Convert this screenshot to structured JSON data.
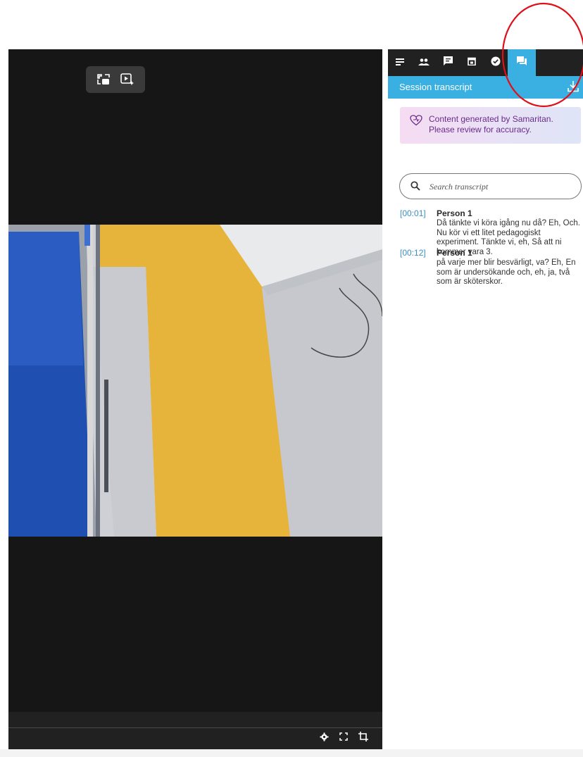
{
  "video": {
    "top_controls": [
      {
        "icon": "exit-fullscreen-icon"
      },
      {
        "icon": "play-ai-icon"
      }
    ],
    "bottom_controls": [
      {
        "icon": "settings-gear-icon"
      },
      {
        "icon": "fullscreen-icon"
      },
      {
        "icon": "crop-icon"
      }
    ]
  },
  "panel": {
    "tabs": [
      {
        "icon": "notes-lines-icon",
        "active": false
      },
      {
        "icon": "people-icon",
        "active": false
      },
      {
        "icon": "comment-icon",
        "active": false
      },
      {
        "icon": "calendar-icon",
        "active": false
      },
      {
        "icon": "check-circle-icon",
        "active": false
      },
      {
        "icon": "transcript-chat-icon",
        "active": true
      }
    ],
    "header_title": "Session transcript",
    "download_icon": "download-icon",
    "ai_notice": {
      "line1": "Content generated by Samaritan.",
      "line2": "Please review for accuracy.",
      "icon": "heart-ai-icon"
    },
    "search": {
      "placeholder": "Search transcript",
      "value": ""
    },
    "entries": [
      {
        "timestamp": "[00:01]",
        "speaker": "Person 1",
        "text": "Då tänkte vi köra igång nu då? Eh, Och. Nu kör vi ett litet pedagogiskt experiment. Tänkte vi, eh, Så att ni kommer vara 3."
      },
      {
        "timestamp": "[00:12]",
        "speaker": "Person 1",
        "text": "på varje mer blir besvärligt, va? Eh, En som är undersökande och, eh, ja, två som är sköterskor."
      }
    ]
  },
  "colors": {
    "accent": "#3ab0e2",
    "tabbar": "#212121",
    "video_bg": "#161616",
    "timestamp": "#3a8fc0",
    "notice_text": "#6a2a8a",
    "highlight_circle": "#e0101a"
  }
}
